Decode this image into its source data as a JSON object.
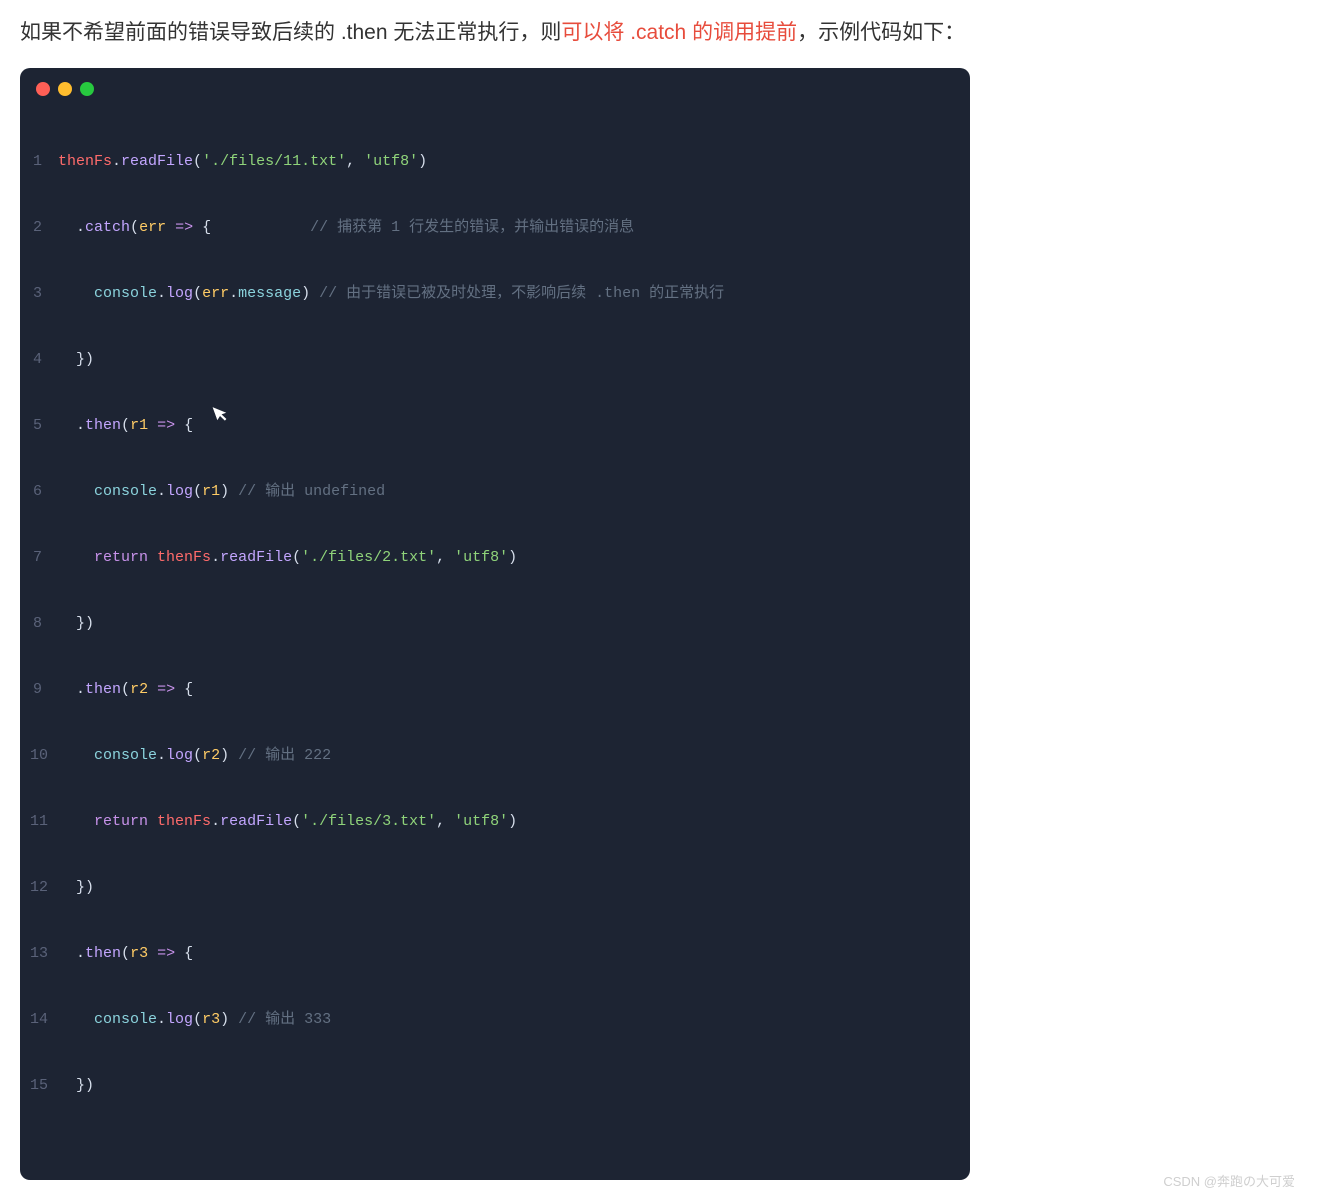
{
  "intro": {
    "part1": "如果不希望前面的错误导致后续的 .then 无法正常执行，则",
    "highlight": "可以将 .catch 的调用提前",
    "part2": "，示例代码如下：",
    "highlight_color": "#e74c3c"
  },
  "window": {
    "dots": [
      "red",
      "yellow",
      "green"
    ]
  },
  "code": {
    "var_thenFs": "thenFs",
    "m_readFile": "readFile",
    "m_catch": "catch",
    "m_then": "then",
    "m_log": "log",
    "obj_console": "console",
    "prop_message": "message",
    "kw_return": "return",
    "arrow": "=>",
    "str_file11": "'./files/11.txt'",
    "str_file2": "'./files/2.txt'",
    "str_file3": "'./files/3.txt'",
    "str_utf8": "'utf8'",
    "param_err": "err",
    "param_r1": "r1",
    "param_r2": "r2",
    "param_r3": "r3",
    "cmt_line2": "// 捕获第 1 行发生的错误，并输出错误的消息",
    "cmt_line3": "// 由于错误已被及时处理，不影响后续 .then 的正常执行",
    "cmt_line6": "// 输出 undefined",
    "cmt_line10": "// 输出 222",
    "cmt_line14": "// 输出 333",
    "line_numbers": [
      "1",
      "2",
      "3",
      "4",
      "5",
      "6",
      "7",
      "8",
      "9",
      "10",
      "11",
      "12",
      "13",
      "14",
      "15"
    ]
  },
  "watermark": "CSDN @奔跑の大可爱"
}
